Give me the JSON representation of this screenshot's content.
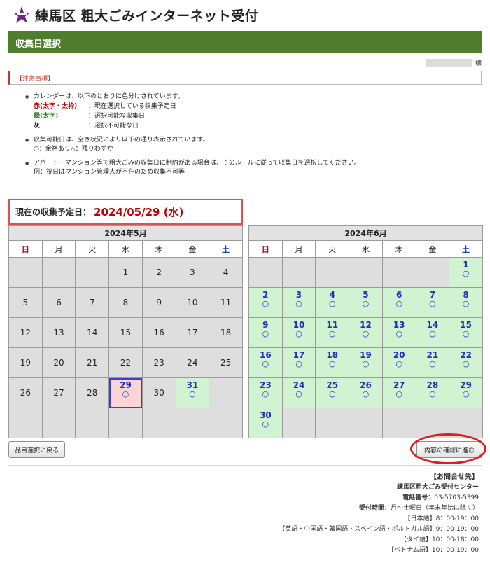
{
  "header": {
    "title": "練馬区 粗大ごみインターネット受付"
  },
  "banner": {
    "title": "収集日選択"
  },
  "user": {
    "suffix": "様"
  },
  "notice": {
    "label": "【注意事項】"
  },
  "notes": {
    "calendar_intro": "カレンダーは、以下のとおりに色分けされています。",
    "legend": [
      {
        "key_color": "赤",
        "key_detail": "(太字・太枠)",
        "sep": "：",
        "text": "現在選択している収集予定日"
      },
      {
        "key_color": "緑",
        "key_detail": "(太字)",
        "sep": "：",
        "text": "選択可能な収集日"
      },
      {
        "key_color": "灰",
        "key_detail": "",
        "sep": "：",
        "text": "選択不可能な日"
      }
    ],
    "availability_intro": "収集可能日は、空き状況により以下の通り表示されています。",
    "availability_legend": "○：余裕あり△：残りわずか",
    "apartment_note": "アパート・マンション等で粗大ごみの収集日に制約がある場合は、そのルールに従って収集日を選択してください。",
    "apartment_example": "例：祝日はマンション管理人が不在のため収集不可等"
  },
  "current": {
    "label": "現在の収集予定日：",
    "date": "2024/05/29 (水)"
  },
  "weekdays": [
    "日",
    "月",
    "火",
    "水",
    "木",
    "金",
    "土"
  ],
  "calendars": [
    {
      "title": "2024年5月",
      "weeks": [
        [
          null,
          null,
          null,
          {
            "d": "1"
          },
          {
            "d": "2"
          },
          {
            "d": "3"
          },
          {
            "d": "4"
          }
        ],
        [
          {
            "d": "5"
          },
          {
            "d": "6"
          },
          {
            "d": "7"
          },
          {
            "d": "8"
          },
          {
            "d": "9"
          },
          {
            "d": "10"
          },
          {
            "d": "11"
          }
        ],
        [
          {
            "d": "12"
          },
          {
            "d": "13"
          },
          {
            "d": "14"
          },
          {
            "d": "15"
          },
          {
            "d": "16"
          },
          {
            "d": "17"
          },
          {
            "d": "18"
          }
        ],
        [
          {
            "d": "19"
          },
          {
            "d": "20"
          },
          {
            "d": "21"
          },
          {
            "d": "22"
          },
          {
            "d": "23"
          },
          {
            "d": "24"
          },
          {
            "d": "25"
          }
        ],
        [
          {
            "d": "26"
          },
          {
            "d": "27"
          },
          {
            "d": "28"
          },
          {
            "d": "29",
            "s": "current",
            "a": "○"
          },
          {
            "d": "30"
          },
          {
            "d": "31",
            "s": "select",
            "a": "○"
          },
          null
        ],
        [
          null,
          null,
          null,
          null,
          null,
          null,
          null
        ]
      ]
    },
    {
      "title": "2024年6月",
      "weeks": [
        [
          null,
          null,
          null,
          null,
          null,
          null,
          {
            "d": "1",
            "s": "select",
            "a": "○"
          }
        ],
        [
          {
            "d": "2",
            "s": "select",
            "a": "○"
          },
          {
            "d": "3",
            "s": "select",
            "a": "○"
          },
          {
            "d": "4",
            "s": "select",
            "a": "○"
          },
          {
            "d": "5",
            "s": "select",
            "a": "○"
          },
          {
            "d": "6",
            "s": "select",
            "a": "○"
          },
          {
            "d": "7",
            "s": "select",
            "a": "○"
          },
          {
            "d": "8",
            "s": "select",
            "a": "○"
          }
        ],
        [
          {
            "d": "9",
            "s": "select",
            "a": "○"
          },
          {
            "d": "10",
            "s": "select",
            "a": "○"
          },
          {
            "d": "11",
            "s": "select",
            "a": "○"
          },
          {
            "d": "12",
            "s": "select",
            "a": "○"
          },
          {
            "d": "13",
            "s": "select",
            "a": "○"
          },
          {
            "d": "14",
            "s": "select",
            "a": "○"
          },
          {
            "d": "15",
            "s": "select",
            "a": "○"
          }
        ],
        [
          {
            "d": "16",
            "s": "select",
            "a": "○"
          },
          {
            "d": "17",
            "s": "select",
            "a": "○"
          },
          {
            "d": "18",
            "s": "select",
            "a": "○"
          },
          {
            "d": "19",
            "s": "select",
            "a": "○"
          },
          {
            "d": "20",
            "s": "select",
            "a": "○"
          },
          {
            "d": "21",
            "s": "select",
            "a": "○"
          },
          {
            "d": "22",
            "s": "select",
            "a": "○"
          }
        ],
        [
          {
            "d": "23",
            "s": "select",
            "a": "○"
          },
          {
            "d": "24",
            "s": "select",
            "a": "○"
          },
          {
            "d": "25",
            "s": "select",
            "a": "○"
          },
          {
            "d": "26",
            "s": "select",
            "a": "○"
          },
          {
            "d": "27",
            "s": "select",
            "a": "○"
          },
          {
            "d": "28",
            "s": "select",
            "a": "○"
          },
          {
            "d": "29",
            "s": "select",
            "a": "○"
          }
        ],
        [
          {
            "d": "30",
            "s": "select",
            "a": "○"
          },
          null,
          null,
          null,
          null,
          null,
          null
        ]
      ]
    }
  ],
  "buttons": {
    "back": "品目選択に戻る",
    "next": "内容の確認に進む"
  },
  "contact": {
    "title": "【お問合せ先】",
    "center": "練馬区粗大ごみ受付センター",
    "phone_label": "電話番号：",
    "phone": "03-5703-5399",
    "hours_label": "受付時間：",
    "hours": "月～土曜日（年末年始は除く）",
    "lines": [
      "【日本語】8：00-19：00",
      "【英語・中国語・韓国語・スペイン語・ポルトガル語】9：00-19：00",
      "【タイ語】10：00-18：00",
      "【ベトナム語】10：00-19：00"
    ]
  },
  "colors": {
    "banner": "#4e7d2d",
    "selectable": "#d2f3d2",
    "current": "#fbd5d5",
    "unavailable": "#dedede",
    "sunday": "#c00000",
    "saturday": "#1e3fbf"
  }
}
